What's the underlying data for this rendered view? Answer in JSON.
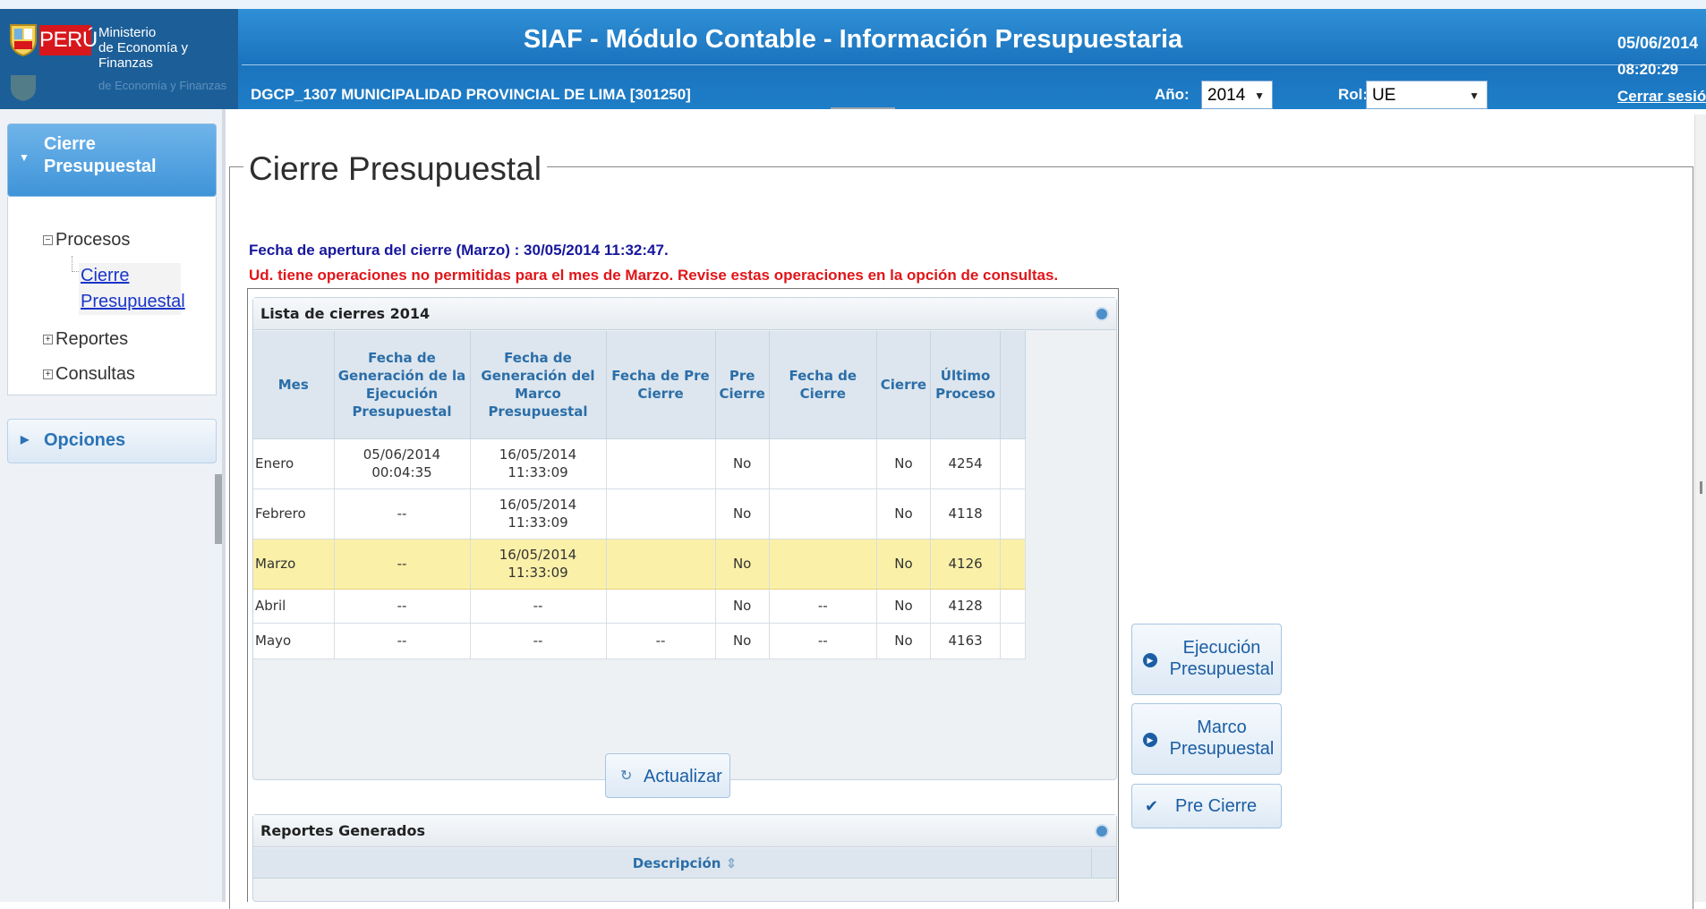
{
  "header": {
    "logo_text": "PERÚ",
    "ministry_line1": "Ministerio",
    "ministry_line2": "de Economía y Finanzas",
    "ministry_faded": "de Economía y Finanzas",
    "app_title": "SIAF - Módulo Contable - Información Presupuestaria",
    "entity": "DGCP_1307  MUNICIPALIDAD PROVINCIAL DE LIMA  [301250]",
    "year_label": "Año:",
    "year_value": "2014",
    "rol_label": "Rol:",
    "rol_value": "UE",
    "date": "05/06/2014",
    "time": "08:20:29",
    "logout": "Cerrar sesión"
  },
  "sidebar": {
    "active_section": "Cierre Presupuestal",
    "tree": {
      "procesos": "Procesos",
      "cierre_item": "Cierre Presupuestal",
      "reportes": "Reportes",
      "consultas": "Consultas"
    },
    "options_section": "Opciones"
  },
  "main": {
    "title": "Cierre Presupuestal",
    "info_line": "Fecha de apertura del cierre (Marzo) : 30/05/2014 11:32:47.",
    "warning_line": "Ud. tiene operaciones no permitidas para el mes de Marzo. Revise estas operaciones en la opción de consultas.",
    "list_panel_title": "Lista de cierres 2014",
    "columns": {
      "mes": "Mes",
      "fecha_ejecucion": "Fecha de Generación de la Ejecución Presupuestal",
      "fecha_marco": "Fecha de Generación del Marco Presupuestal",
      "fecha_precierre": "Fecha de Pre Cierre",
      "precierre": "Pre Cierre",
      "fecha_cierre": "Fecha de Cierre",
      "cierre": "Cierre",
      "ultimo_proceso": "Último Proceso"
    },
    "rows": [
      {
        "mes": "Enero",
        "fecha_ejecucion": "05/06/2014 00:04:35",
        "fecha_marco": "16/05/2014 11:33:09",
        "fecha_precierre": "",
        "precierre": "No",
        "fecha_cierre": "",
        "cierre": "No",
        "ultimo_proceso": "4254"
      },
      {
        "mes": "Febrero",
        "fecha_ejecucion": "--",
        "fecha_marco": "16/05/2014 11:33:09",
        "fecha_precierre": "",
        "precierre": "No",
        "fecha_cierre": "",
        "cierre": "No",
        "ultimo_proceso": "4118"
      },
      {
        "mes": "Marzo",
        "fecha_ejecucion": "--",
        "fecha_marco": "16/05/2014 11:33:09",
        "fecha_precierre": "",
        "precierre": "No",
        "fecha_cierre": "",
        "cierre": "No",
        "ultimo_proceso": "4126"
      },
      {
        "mes": "Abril",
        "fecha_ejecucion": "--",
        "fecha_marco": "--",
        "fecha_precierre": "",
        "precierre": "No",
        "fecha_cierre": "--",
        "cierre": "No",
        "ultimo_proceso": "4128"
      },
      {
        "mes": "Mayo",
        "fecha_ejecucion": "--",
        "fecha_marco": "--",
        "fecha_precierre": "--",
        "precierre": "No",
        "fecha_cierre": "--",
        "cierre": "No",
        "ultimo_proceso": "4163"
      }
    ],
    "highlight_row_color": "#fbf0a8",
    "update_button": "Actualizar",
    "reports_panel_title": "Reportes Generados",
    "reports_column": "Descripción"
  },
  "actions": {
    "ejecucion_line1": "Ejecución",
    "ejecucion_line2": "Presupuestal",
    "marco_line1": "Marco",
    "marco_line2": "Presupuestal",
    "precierre": "Pre Cierre"
  },
  "colors": {
    "header_blue": "#1b73bd",
    "warning_red": "#e0161a",
    "info_blue": "#17179d",
    "logo_red": "#d8171c"
  },
  "icons": {
    "logo": "peru-shield-icon",
    "dropdown": "chevron-down-icon",
    "collapse": "collapse-circle-icon",
    "refresh": "refresh-icon",
    "play": "play-circle-icon",
    "check": "check-icon",
    "sort": "sort-icon"
  }
}
